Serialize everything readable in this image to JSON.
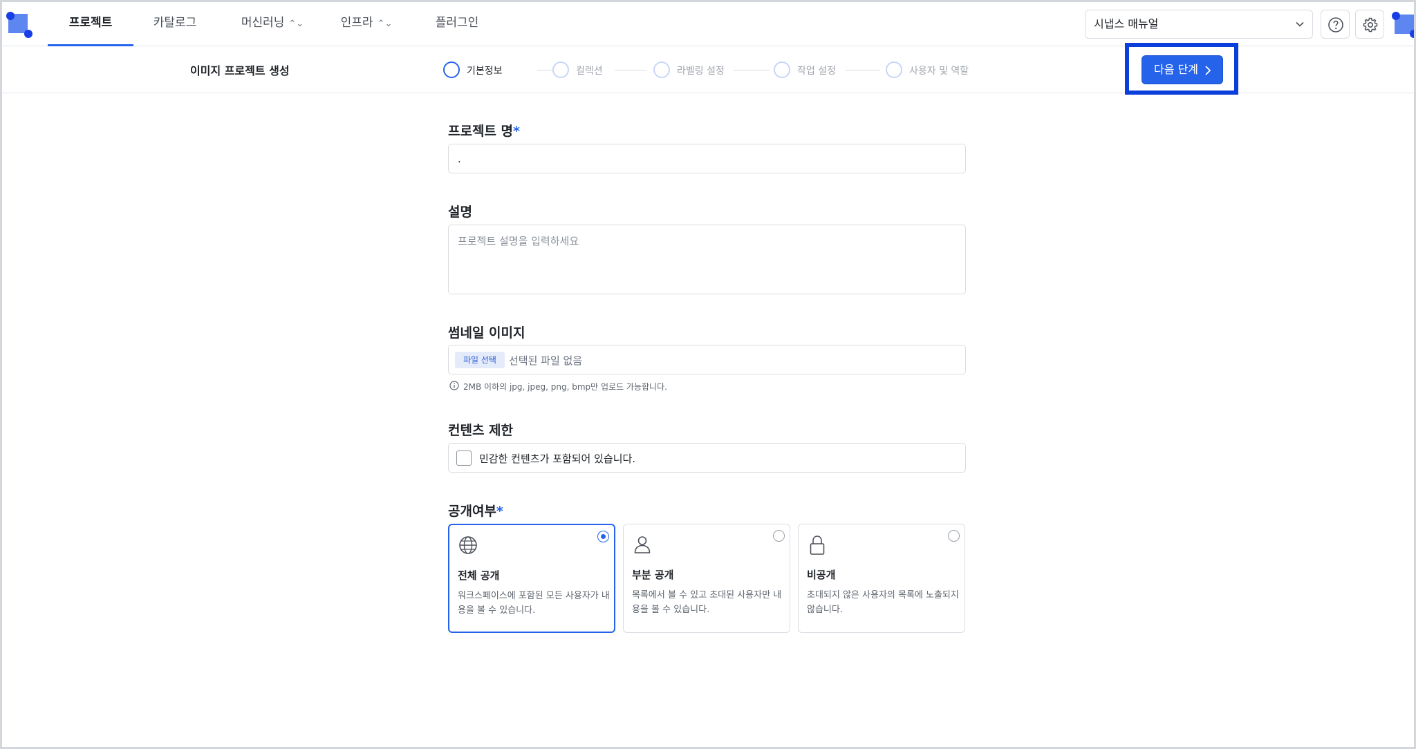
{
  "nav": {
    "tabs": [
      {
        "label": "프로젝트"
      },
      {
        "label": "카탈로그"
      },
      {
        "label": "머신러닝"
      },
      {
        "label": "인프라"
      },
      {
        "label": "플러그인"
      }
    ],
    "active_tab": "프로젝트",
    "workspace_select": "시냅스 매뉴얼",
    "help_icon": "question-circle-icon",
    "settings_icon": "gear-icon"
  },
  "subheader": {
    "page_title": "이미지 프로젝트 생성",
    "steps": [
      {
        "label": "기본정보"
      },
      {
        "label": "컬렉션"
      },
      {
        "label": "라벨링 설정"
      },
      {
        "label": "작업 설정"
      },
      {
        "label": "사용자 및 역할"
      }
    ],
    "current_step": "기본정보",
    "next_button": "다음 단계"
  },
  "form": {
    "project_name": {
      "label": "프로젝트 명",
      "required_mark": "*",
      "value": "."
    },
    "description": {
      "label": "설명",
      "placeholder": "프로젝트 설명을 입력하세요"
    },
    "thumbnail": {
      "label": "썸네일 이미지",
      "file_button": "파일 선택",
      "file_status": "선택된 파일 없음",
      "hint": "2MB 이하의 jpg, jpeg, png, bmp만 업로드 가능합니다."
    },
    "content_restriction": {
      "label": "컨텐츠 제한",
      "checkbox_label": "민감한 컨텐츠가 포함되어 있습니다.",
      "checked": false
    },
    "visibility": {
      "label": "공개여부",
      "required_mark": "*",
      "options": [
        {
          "title": "전체 공개",
          "desc": "워크스페이스에 포함된 모든 사용자가 내용을 볼 수 있습니다.",
          "icon": "globe-icon",
          "selected": true
        },
        {
          "title": "부분 공개",
          "desc": "목록에서 볼 수 있고 초대된 사용자만 내용을 볼 수 있습니다.",
          "icon": "user-icon",
          "selected": false
        },
        {
          "title": "비공개",
          "desc": "초대되지 않은 사용자의 목록에 노출되지 않습니다.",
          "icon": "lock-icon",
          "selected": false
        }
      ]
    }
  },
  "colors": {
    "accent": "#2563eb",
    "highlight_box": "#0b3fdc"
  }
}
